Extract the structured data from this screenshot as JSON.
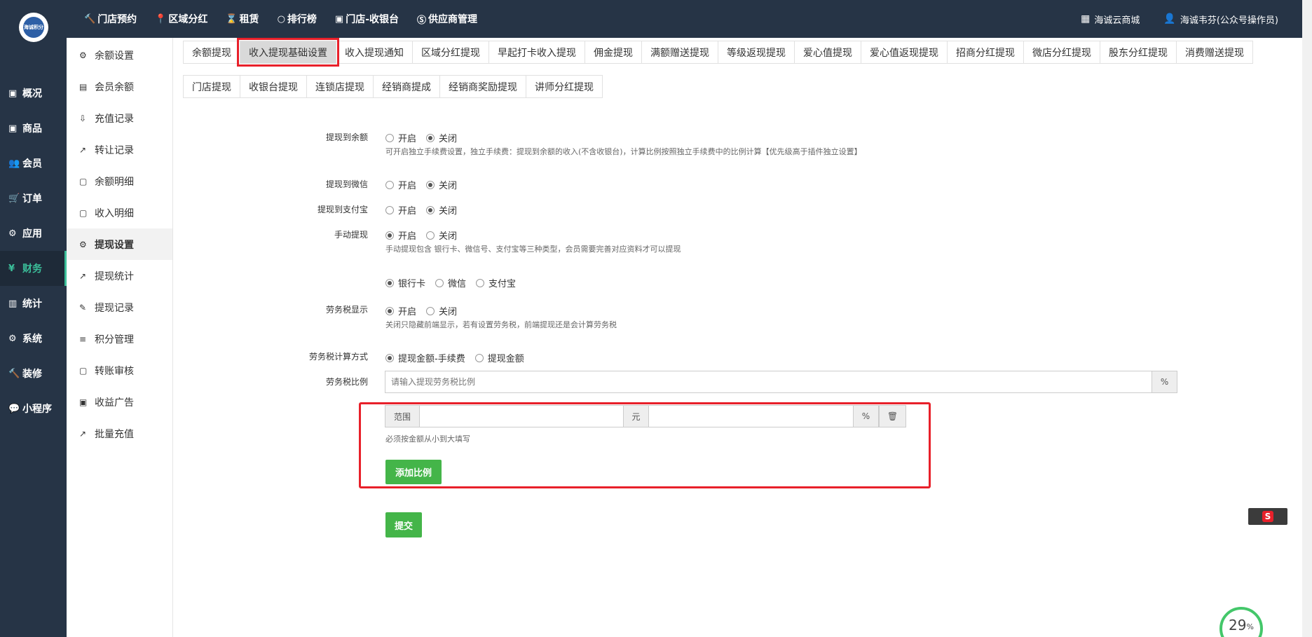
{
  "logo": {
    "text": "海诚积分"
  },
  "topnav": [
    {
      "icon": "hammer-icon",
      "glyph": "🔨",
      "label": "门店预约"
    },
    {
      "icon": "pin-icon",
      "glyph": "📍",
      "label": "区域分红"
    },
    {
      "icon": "hourglass-icon",
      "glyph": "⌛",
      "label": "租赁"
    },
    {
      "icon": "circle-icon",
      "glyph": "○",
      "label": "排行榜"
    },
    {
      "icon": "cash-icon",
      "glyph": "▣",
      "label": "门店-收银台"
    },
    {
      "icon": "skype-icon",
      "glyph": "Ⓢ",
      "label": "供应商管理"
    }
  ],
  "topright": {
    "shop": {
      "icon": "grid-icon",
      "glyph": "▦",
      "label": "海诚云商城"
    },
    "user": {
      "icon": "user-icon",
      "glyph": "👤",
      "label": "海诚韦芬(公众号操作员)"
    }
  },
  "mainside": [
    {
      "name": "overview",
      "glyph": "▣",
      "label": "概况"
    },
    {
      "name": "goods",
      "glyph": "▣",
      "label": "商品"
    },
    {
      "name": "members",
      "glyph": "👥",
      "label": "会员"
    },
    {
      "name": "orders",
      "glyph": "🛒",
      "label": "订单"
    },
    {
      "name": "apps",
      "glyph": "⚙",
      "label": "应用"
    },
    {
      "name": "finance",
      "glyph": "¥",
      "label": "财务"
    },
    {
      "name": "stats",
      "glyph": "▥",
      "label": "统计"
    },
    {
      "name": "system",
      "glyph": "⚙",
      "label": "系统"
    },
    {
      "name": "decorate",
      "glyph": "🔨",
      "label": "装修"
    },
    {
      "name": "miniprogram",
      "glyph": "💬",
      "label": "小程序"
    }
  ],
  "subside": [
    {
      "name": "balance-settings",
      "glyph": "⚙",
      "label": "余额设置"
    },
    {
      "name": "member-balance",
      "glyph": "▤",
      "label": "会员余额"
    },
    {
      "name": "recharge-records",
      "glyph": "⇩",
      "label": "充值记录"
    },
    {
      "name": "transfer-records",
      "glyph": "↗",
      "label": "转让记录"
    },
    {
      "name": "balance-details",
      "glyph": "▢",
      "label": "余额明细"
    },
    {
      "name": "income-details",
      "glyph": "▢",
      "label": "收入明细"
    },
    {
      "name": "withdraw-settings",
      "glyph": "⚙",
      "label": "提现设置"
    },
    {
      "name": "withdraw-stats",
      "glyph": "↗",
      "label": "提现统计"
    },
    {
      "name": "withdraw-records",
      "glyph": "✎",
      "label": "提现记录"
    },
    {
      "name": "points-management",
      "glyph": "≡",
      "label": "积分管理"
    },
    {
      "name": "transfer-review",
      "glyph": "▢",
      "label": "转账审核"
    },
    {
      "name": "income-ads",
      "glyph": "▣",
      "label": "收益广告"
    },
    {
      "name": "batch-recharge",
      "glyph": "↗",
      "label": "批量充值"
    }
  ],
  "tabs_row1": [
    "余额提现",
    "收入提现基础设置",
    "收入提现通知",
    "区域分红提现",
    "早起打卡收入提现",
    "佣金提现",
    "满额赠送提现",
    "等级返现提现",
    "爱心值提现",
    "爱心值返现提现",
    "招商分红提现",
    "微店分红提现",
    "股东分红提现",
    "消费赠送提现"
  ],
  "tabs_row2": [
    "门店提现",
    "收银台提现",
    "连锁店提现",
    "经销商提成",
    "经销商奖励提现",
    "讲师分红提现"
  ],
  "form": {
    "to_balance": {
      "label": "提现到余额",
      "on": "开启",
      "off": "关闭",
      "help": "可开启独立手续费设置，独立手续费：提现到余额的收入(不含收银台)，计算比例按照独立手续费中的比例计算【优先级高于插件独立设置】"
    },
    "to_wechat": {
      "label": "提现到微信",
      "on": "开启",
      "off": "关闭"
    },
    "to_alipay": {
      "label": "提现到支付宝",
      "on": "开启",
      "off": "关闭"
    },
    "manual": {
      "label": "手动提现",
      "on": "开启",
      "off": "关闭",
      "help": "手动提现包含 银行卡、微信号、支付宝等三种类型，会员需要完善对应资料才可以提现"
    },
    "manual_types": {
      "bank": "银行卡",
      "wechat": "微信",
      "alipay": "支付宝"
    },
    "labor_tax_display": {
      "label": "劳务税显示",
      "on": "开启",
      "off": "关闭",
      "help": "关闭只隐藏前端显示，若有设置劳务税，前端提现还是会计算劳务税"
    },
    "labor_tax_method": {
      "label": "劳务税计算方式",
      "opt1": "提现金额-手续费",
      "opt2": "提现金额"
    },
    "labor_tax_ratio": {
      "label": "劳务税比例",
      "placeholder": "请输入提现劳务税比例",
      "suffix": "%"
    },
    "range": {
      "prefix": "范围",
      "mid": "元",
      "suffix": "%",
      "help": "必须按金额从小到大填写",
      "add_button": "添加比例"
    },
    "submit": "提交"
  },
  "progress": {
    "value": "29",
    "unit": "%"
  }
}
